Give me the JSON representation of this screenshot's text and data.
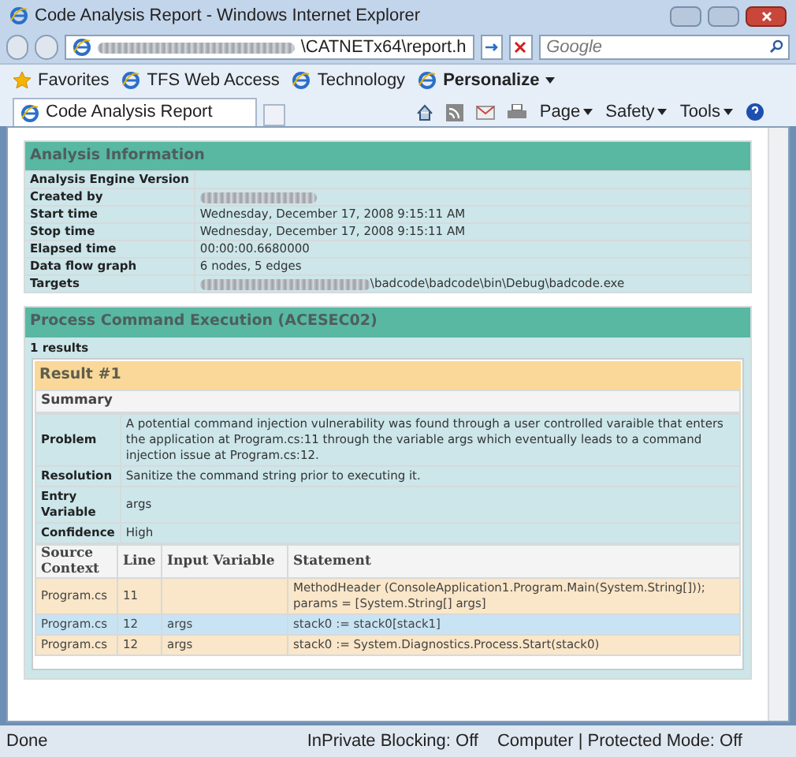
{
  "window": {
    "title": "Code Analysis Report - Windows Internet Explorer"
  },
  "address_bar": {
    "value": "\\CATNETx64\\report.h",
    "search_placeholder": "Google"
  },
  "favorites_bar": {
    "items": [
      {
        "label": "Favorites",
        "kind": "star"
      },
      {
        "label": "TFS Web Access",
        "kind": "ie"
      },
      {
        "label": "Technology",
        "kind": "ie"
      },
      {
        "label": "Personalize",
        "kind": "menu"
      }
    ]
  },
  "tabs": [
    {
      "label": "Code Analysis Report",
      "selected": true
    }
  ],
  "command_bar": [
    "Page",
    "Safety",
    "Tools"
  ],
  "analysis": {
    "title": "Analysis Information",
    "rows": [
      {
        "label": "Analysis Engine Version"
      },
      {
        "label": "Created by",
        "blurred": true
      },
      {
        "label": "Start time",
        "value": "Wednesday, December 17, 2008 9:15:11 AM"
      },
      {
        "label": "Stop time",
        "value": "Wednesday, December 17, 2008 9:15:11 AM"
      },
      {
        "label": "Elapsed time",
        "value": "00:00:00.6680000"
      },
      {
        "label": "Data flow graph",
        "value": "6 nodes, 5 edges"
      },
      {
        "label": "Targets",
        "value": "\\badcode\\badcode\\bin\\Debug\\badcode.exe",
        "blurred": true
      }
    ]
  },
  "rule": {
    "title": "Process Command Execution (ACESEC02)",
    "count": "1 results",
    "result": {
      "title": "Result #1",
      "summary": "Summary",
      "rows": [
        {
          "label": "Problem",
          "value": "A potential command injection vulnerability was found through a user controlled varaible that enters the application at Program.cs:11 through the variable args which eventually leads to a command injection issue at Program.cs:12."
        },
        {
          "label": "Resolution",
          "value": "Sanitize the command string prior to executing it."
        },
        {
          "label": "Entry Variable",
          "value": "args"
        },
        {
          "label": "Confidence",
          "value": "High"
        }
      ],
      "columns": [
        "Source Context",
        "Line",
        "Input Variable",
        "Statement"
      ],
      "trace": [
        {
          "cells": [
            "Program.cs",
            "11",
            "",
            "MethodHeader (ConsoleApplication1.Program.Main(System.String[])); params = [System.String[] args]"
          ],
          "selected": false
        },
        {
          "cells": [
            "Program.cs",
            "12",
            "args",
            "stack0 := stack0[stack1]"
          ],
          "selected": true
        },
        {
          "cells": [
            "Program.cs",
            "12",
            "args",
            "stack0 := System.Diagnostics.Process.Start(stack0)"
          ],
          "selected": false
        }
      ]
    }
  },
  "status_bar": {
    "text": "Done",
    "inprivate": "InPrivate Blocking: Off",
    "zone": "Computer | Protected Mode: Off"
  }
}
